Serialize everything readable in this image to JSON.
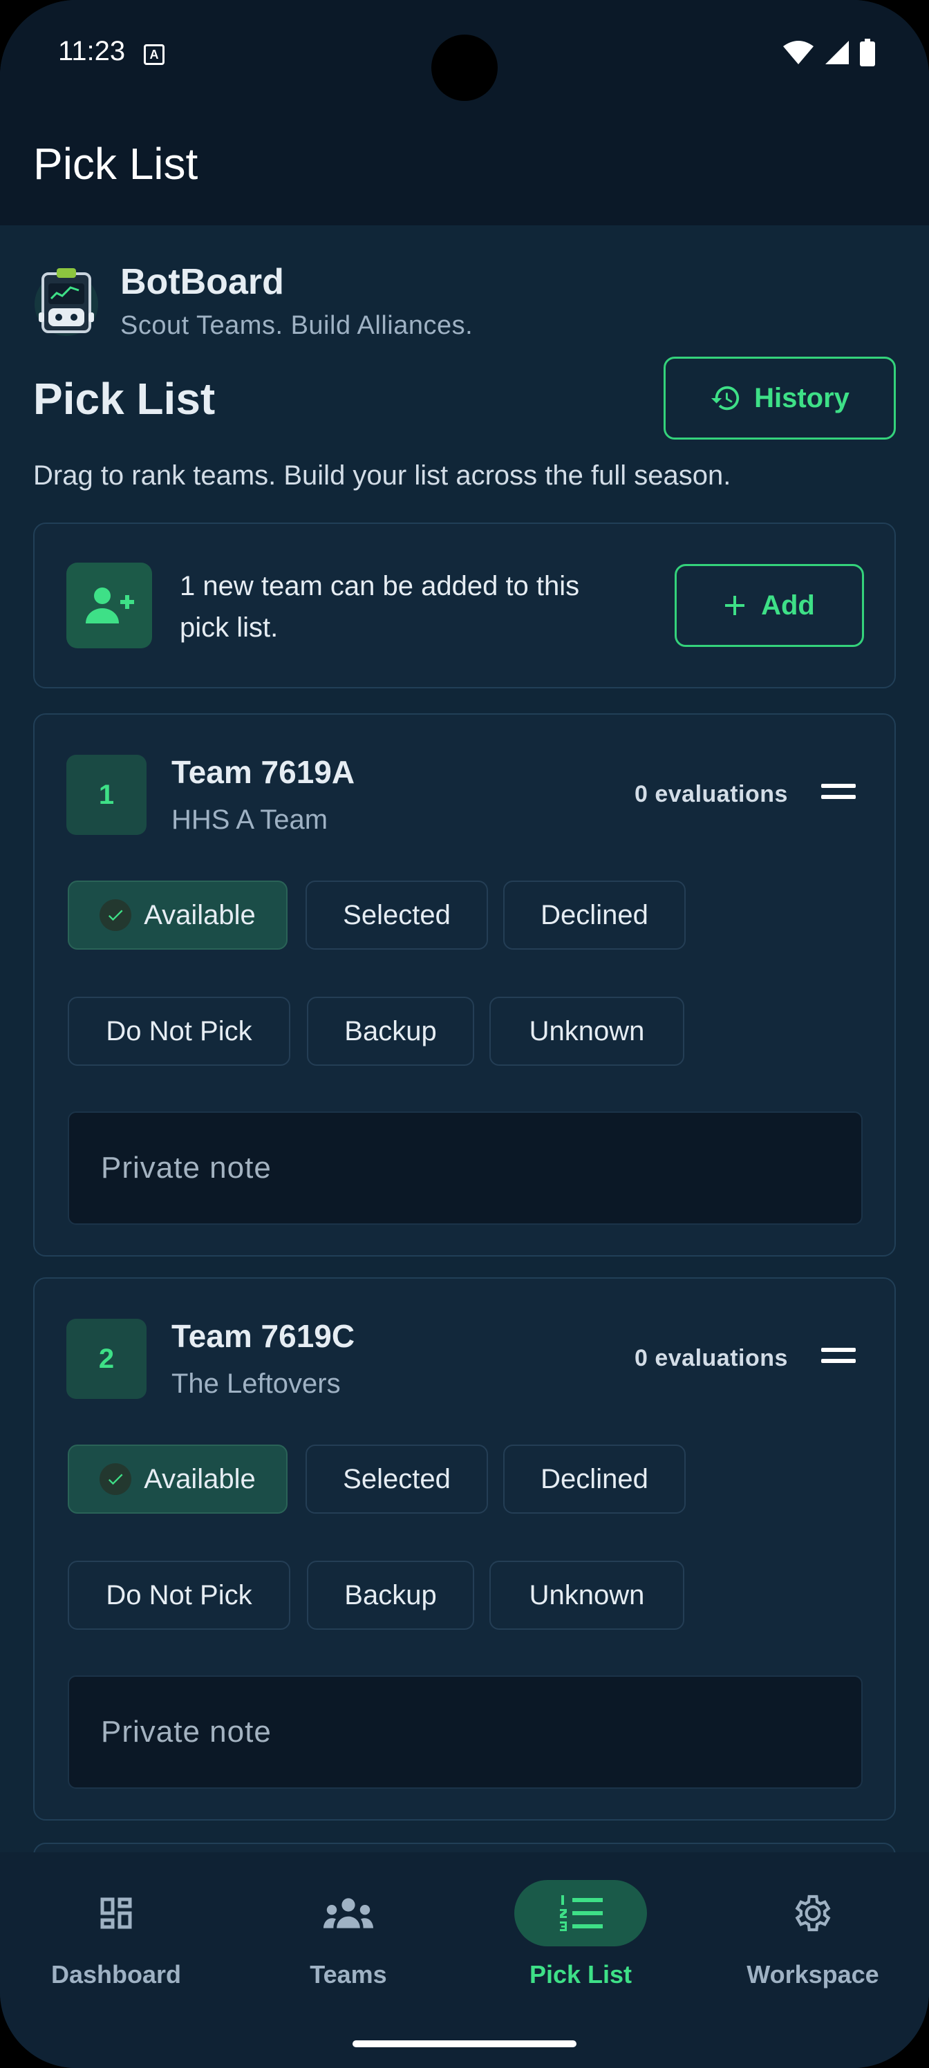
{
  "status_bar": {
    "time": "11:23",
    "notification_glyph": "A"
  },
  "app_bar": {
    "title": "Pick List"
  },
  "brand": {
    "name": "BotBoard",
    "tagline": "Scout Teams. Build Alliances."
  },
  "header": {
    "title": "Pick List",
    "history_label": "History",
    "subtitle": "Drag to rank teams. Build your list across the full season."
  },
  "add_banner": {
    "message": "1 new team can be added to this pick list.",
    "add_label": "Add"
  },
  "status_options": [
    "Available",
    "Selected",
    "Declined",
    "Do Not Pick",
    "Backup",
    "Unknown"
  ],
  "teams": [
    {
      "rank": "1",
      "name": "Team 7619A",
      "subtitle": "HHS A Team",
      "evaluations": "0 evaluations",
      "selected_status": "Available",
      "note_placeholder": "Private note"
    },
    {
      "rank": "2",
      "name": "Team 7619C",
      "subtitle": "The Leftovers",
      "evaluations": "0 evaluations",
      "selected_status": "Available",
      "note_placeholder": "Private note"
    }
  ],
  "bottom_nav": {
    "items": [
      {
        "label": "Dashboard",
        "icon": "dashboard-icon",
        "active": false
      },
      {
        "label": "Teams",
        "icon": "groups-icon",
        "active": false
      },
      {
        "label": "Pick List",
        "icon": "numbered-list-icon",
        "active": true
      },
      {
        "label": "Workspace",
        "icon": "gear-icon",
        "active": false
      }
    ]
  },
  "colors": {
    "accent": "#3ee087",
    "background": "#102638",
    "card": "#12283b",
    "appbar": "#0b1928"
  }
}
